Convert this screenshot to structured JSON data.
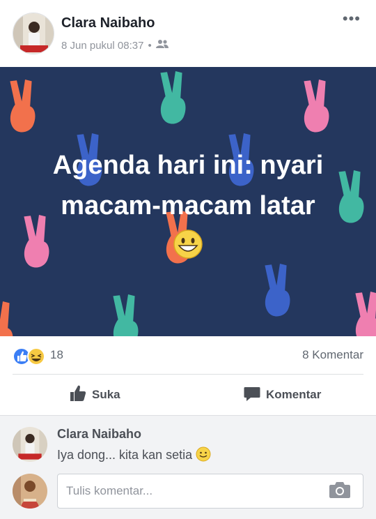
{
  "post": {
    "author": "Clara Naibaho",
    "timestamp": "8 Jun pukul 08:37",
    "separator": "•",
    "privacy_icon": "friends-icon",
    "more_label": "•••",
    "text_line1": "Agenda hari ini: nyari",
    "text_line2": "macam-macam latar",
    "text_emoji": "grinning-face-emoji",
    "background_color": "#24375e"
  },
  "reactions": {
    "icons": [
      "like-reaction-icon",
      "haha-reaction-icon"
    ],
    "count": "18",
    "comments_label": "8 Komentar"
  },
  "actions": {
    "like_label": "Suka",
    "comment_label": "Komentar"
  },
  "comments": [
    {
      "author": "Clara Naibaho",
      "text": "Iya dong... kita kan setia",
      "emoji": "slightly-smiling-face-emoji"
    }
  ],
  "composer": {
    "placeholder": "Tulis komentar...",
    "camera_icon": "camera-icon"
  }
}
